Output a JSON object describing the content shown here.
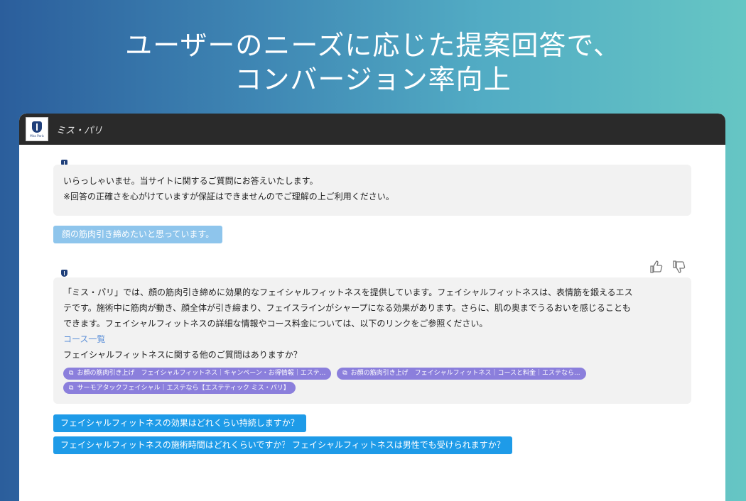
{
  "headline": {
    "line1": "ユーザーのニーズに応じた提案回答で、",
    "line2": "コンバージョン率向上"
  },
  "window": {
    "brand_name": "ミス・パリ",
    "logo_text": "Miss Paris"
  },
  "chat": {
    "greeting": {
      "line1": "いらっしゃいませ。当サイトに関するご質問にお答えいたします。",
      "line2": "※回答の正確さを心がけていますが保証はできませんのでご理解の上ご利用ください。"
    },
    "user_message": "顔の筋肉引き締めたいと思っています。",
    "feedback": {
      "like_icon": "thumbs-up-icon",
      "dislike_icon": "thumbs-down-icon"
    },
    "answer": {
      "line1": "「ミス・パリ」では、顔の筋肉引き締めに効果的なフェイシャルフィットネスを提供しています。フェイシャルフィットネスは、表情筋を鍛えるエス",
      "line2": "テです。施術中に筋肉が動き、顔全体が引き締まり、フェイスラインがシャープになる効果があります。さらに、肌の奥までうるおいを感じることも",
      "line3": "できます。フェイシャルフィットネスの詳細な情報やコース料金については、以下のリンクをご参照ください。",
      "link": "コース一覧",
      "followup": "フェイシャルフィットネスに関する他のご質問はありますか？"
    },
    "references": [
      "お顔の筋肉引き上げ　フェイシャルフィットネス｜キャンペーン・お得情報｜エステ...",
      "お顔の筋肉引き上げ　フェイシャルフィットネス｜コースと料金｜エステなら...",
      "サーモアタックフェイシャル｜エステなら【エステティック ミス・パリ】"
    ],
    "suggestions": [
      "フェイシャルフィットネスの効果はどれくらい持続しますか？",
      "フェイシャルフィットネスの施術時間はどれくらいですか？",
      "フェイシャルフィットネスは男性でも受けられますか？"
    ]
  },
  "colors": {
    "gradient_start": "#2b5e9c",
    "gradient_end": "#66c6c4",
    "titlebar": "#2a2a2a",
    "reference_chip": "#8b7fdc",
    "suggestion_button": "#1e9be8",
    "user_bubble": "#8ec5ec"
  }
}
